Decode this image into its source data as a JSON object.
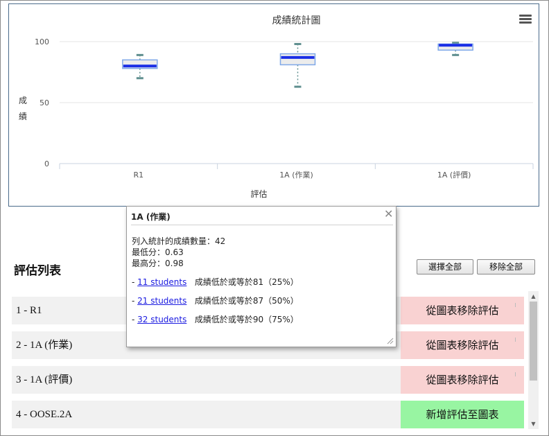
{
  "chart_data": {
    "type": "boxplot",
    "title": "成績統計圖",
    "xlabel": "評估",
    "ylabel": "成績",
    "ylim": [
      0,
      100
    ],
    "yticks": [
      0,
      50,
      100
    ],
    "categories": [
      "R1",
      "1A (作業)",
      "1A (評價)"
    ],
    "boxes": [
      {
        "category": "R1",
        "min": 70,
        "q1": 78,
        "median": 80,
        "q3": 85,
        "max": 89
      },
      {
        "category": "1A (作業)",
        "min": 63,
        "q1": 81,
        "median": 87,
        "q3": 90,
        "max": 98
      },
      {
        "category": "1A (評價)",
        "min": 89,
        "q1": 93,
        "median": 97,
        "q3": 98,
        "max": 99
      }
    ],
    "colors": {
      "box_fill": "#ececec",
      "box_border": "#7fa8e8",
      "median": "#1a2ee6",
      "whisker": "#5f8f8f"
    }
  },
  "chart_menu_icon": "hamburger-menu-icon",
  "tooltip": {
    "title": "1A (作業)",
    "count_text": "列入統計的成績數量：42",
    "min_text": "最低分：0.63",
    "max_text": "最高分：0.98",
    "close_icon": "close-x-icon",
    "rows": [
      {
        "prefix": "- ",
        "link": "11 students",
        "text": "成績低於或等於81（25%）"
      },
      {
        "prefix": "- ",
        "link": "21 students",
        "text": "成績低於或等於87（50%）"
      },
      {
        "prefix": "- ",
        "link": "32 students",
        "text": "成績低於或等於90（75%）"
      }
    ]
  },
  "list": {
    "title": "評估列表",
    "select_all": "選擇全部",
    "remove_all": "移除全部",
    "items": [
      {
        "label": "1 - R1",
        "action": "從圖表移除評估",
        "state": "remove"
      },
      {
        "label": "2 - 1A (作業)",
        "action": "從圖表移除評估",
        "state": "remove"
      },
      {
        "label": "3 - 1A (評價)",
        "action": "從圖表移除評估",
        "state": "remove"
      },
      {
        "label": "4 - OOSE.2A",
        "action": "新增評估至圖表",
        "state": "add"
      }
    ],
    "colors": {
      "remove": "#f9d2d2",
      "add": "#98f5a2"
    }
  }
}
